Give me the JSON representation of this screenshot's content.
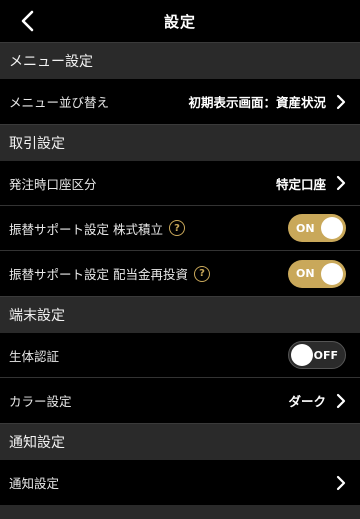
{
  "header": {
    "title": "設定"
  },
  "sections": {
    "menu": {
      "title": "メニュー設定",
      "reorder_label": "メニュー並び替え",
      "reorder_value": "初期表示画面：資産状況"
    },
    "trading": {
      "title": "取引設定",
      "account_label": "発注時口座区分",
      "account_value": "特定口座",
      "transfer_stock_label": "振替サポート設定 株式積立",
      "transfer_stock_toggle": "ON",
      "transfer_dividend_label": "振替サポート設定 配当金再投資",
      "transfer_dividend_toggle": "ON"
    },
    "device": {
      "title": "端末設定",
      "biometric_label": "生体認証",
      "biometric_toggle": "OFF",
      "color_label": "カラー設定",
      "color_value": "ダーク"
    },
    "notification": {
      "title": "通知設定",
      "settings_label": "通知設定"
    }
  },
  "icons": {
    "help": "?",
    "back": "chevron-left-icon",
    "chevron": "chevron-right-icon"
  },
  "colors": {
    "accent": "#c9a85a",
    "background": "#000000",
    "section_bg": "#2a2a2a"
  }
}
